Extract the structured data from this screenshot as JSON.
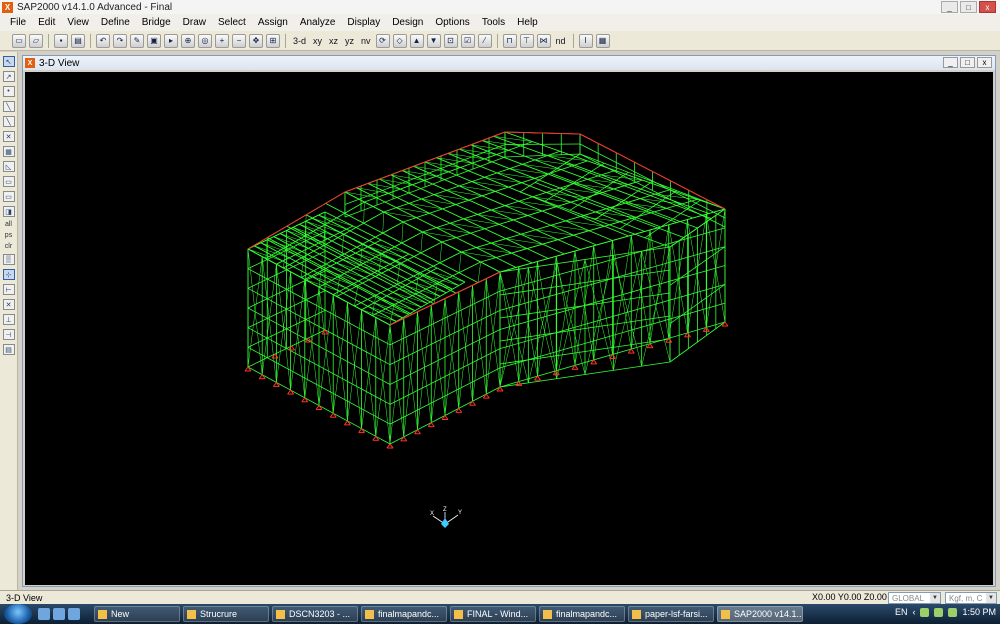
{
  "app": {
    "title": "SAP2000 v14.1.0 Advanced  - Final",
    "logo": "X"
  },
  "window_controls": {
    "minimize": "_",
    "maximize": "□",
    "close": "x"
  },
  "menu": [
    "File",
    "Edit",
    "View",
    "Define",
    "Bridge",
    "Draw",
    "Select",
    "Assign",
    "Analyze",
    "Display",
    "Design",
    "Options",
    "Tools",
    "Help"
  ],
  "toolbar": {
    "view_3d": "3-d",
    "view_xy": "xy",
    "view_xz": "xz",
    "view_yz": "yz",
    "view_nv": "nv",
    "nd": "nd"
  },
  "left_tools": {
    "all": "all",
    "ps": "ps",
    "clr": "clr"
  },
  "view": {
    "title": "3-D View"
  },
  "status": {
    "left": "3-D View",
    "coords": "X0.00  Y0.00  Z0.00",
    "coord_system": "GLOBAL",
    "units": "Kgf, m, C"
  },
  "taskbar": {
    "items": [
      "New",
      "Strucrure",
      "DSCN3203 - ...",
      "finalmapandc...",
      "FINAL - Wind...",
      "finalmapandc...",
      "paper-lsf-farsi...",
      "SAP2000 v14.1..."
    ],
    "lang": "EN",
    "time": "1:50 PM"
  },
  "colors": {
    "structure": "#33ff33",
    "supports": "#ff3030",
    "background": "#000000"
  },
  "axes": {
    "x": "X",
    "y": "Y",
    "z": "Z"
  }
}
